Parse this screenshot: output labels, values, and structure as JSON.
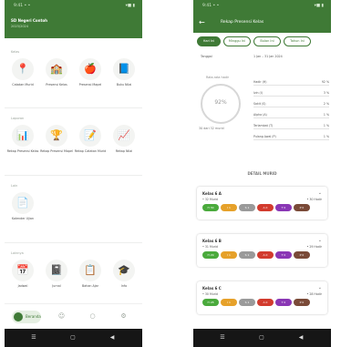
{
  "colors": {
    "primary": "#3f7a36",
    "pills": [
      "#4aaa3c",
      "#e6a12a",
      "#9a9a9a",
      "#d23b2e",
      "#8a37b5",
      "#7a4a38"
    ]
  },
  "status": {
    "left": "9:41 • •",
    "right": "▾■ ▮"
  },
  "home": {
    "school": "SD Negeri Contoh",
    "year": "2023/2024",
    "sections": [
      "Kelas",
      "Laporan",
      "Lain",
      "Lainnya"
    ],
    "row1": [
      {
        "label": "Catatan Murid",
        "icon": "location-pin-icon",
        "glyph": "📍"
      },
      {
        "label": "Presensi Kelas",
        "icon": "class-icon",
        "glyph": "🏫"
      },
      {
        "label": "Presensi Mapel",
        "icon": "apple-icon",
        "glyph": "🍎"
      },
      {
        "label": "Buku Nilai",
        "icon": "book-icon",
        "glyph": "📘"
      }
    ],
    "row2": [
      {
        "label": "Rekap Presensi Kelas",
        "icon": "chart-icon",
        "glyph": "📊"
      },
      {
        "label": "Rekap Presensi Mapel",
        "icon": "trophy-icon",
        "glyph": "🏆"
      },
      {
        "label": "Rekap Catatan Murid",
        "icon": "notes-icon",
        "glyph": "📝"
      },
      {
        "label": "Rekap Nilai",
        "icon": "report-icon",
        "glyph": "📈"
      }
    ],
    "row3": [
      {
        "label": "Kalender Ujian",
        "icon": "document-icon",
        "glyph": "📄"
      }
    ],
    "row4": [
      {
        "label": "Jadwal",
        "icon": "calendar-icon",
        "glyph": "📅"
      },
      {
        "label": "Jurnal",
        "icon": "journal-icon",
        "glyph": "📓"
      },
      {
        "label": "Bahan Ajar",
        "icon": "material-icon",
        "glyph": "📋"
      },
      {
        "label": "Info",
        "icon": "graduation-icon",
        "glyph": "🎓"
      }
    ],
    "nav_home": "Beranda"
  },
  "detail": {
    "title": "Rekap Presensi Kelas",
    "chips": [
      "Hari Ini",
      "Minggu Ini",
      "Bulan Ini",
      "Tahun Ini"
    ],
    "meta_left": "Tanggal",
    "meta_right": "1 Jan – 31 Jan 2024",
    "donut_caption": "Rata-rata hadir",
    "donut_value": "92%",
    "donut_sub": "30 dari 32 murid",
    "rows": [
      {
        "name": "Hadir (H)",
        "value": "92 %"
      },
      {
        "name": "Izin (I)",
        "value": "3 %"
      },
      {
        "name": "Sakit (S)",
        "value": "2 %"
      },
      {
        "name": "Alpha (A)",
        "value": "1 %"
      },
      {
        "name": "Terlambat (T)",
        "value": "1 %"
      },
      {
        "name": "Pulang Awal (P)",
        "value": "1 %"
      }
    ],
    "section_title": "DETAIL MURID",
    "cards": [
      {
        "title": "Kelas 6 A",
        "left": "• 32 Murid",
        "right": "• 30 Hadir",
        "pills": [
          "H 30",
          "I 1",
          "S 1",
          "A 0",
          "T 0",
          "P 0"
        ]
      },
      {
        "title": "Kelas 6 B",
        "left": "• 31 Murid",
        "right": "• 29 Hadir",
        "pills": [
          "H 29",
          "I 1",
          "S 1",
          "A 0",
          "T 0",
          "P 0"
        ]
      },
      {
        "title": "Kelas 6 C",
        "left": "• 30 Murid",
        "right": "• 28 Hadir",
        "pills": [
          "H 28",
          "I 1",
          "S 1",
          "A 0",
          "T 0",
          "P 0"
        ]
      }
    ]
  }
}
